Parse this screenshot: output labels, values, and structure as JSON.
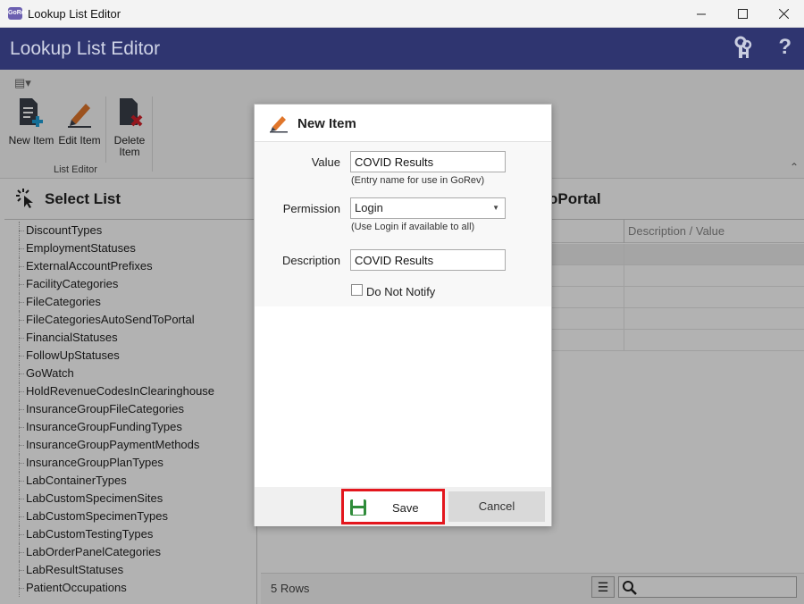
{
  "window": {
    "title": "Lookup List Editor",
    "icon_text": "GoRev",
    "controls": [
      "minimize",
      "maximize",
      "close"
    ]
  },
  "header": {
    "title": "Lookup List Editor",
    "icons": [
      "keys-icon",
      "help-icon"
    ],
    "help_glyph": "?"
  },
  "ribbon": {
    "menu_glyph": "▤▾",
    "buttons": [
      {
        "label": "New Item",
        "icon": "new-item-icon"
      },
      {
        "label": "Edit Item",
        "icon": "edit-item-icon"
      },
      {
        "label": "Delete Item",
        "icon": "delete-item-icon"
      }
    ],
    "group_label": "List Editor",
    "collapse_glyph": "⌃"
  },
  "left_panel": {
    "title": "Select List",
    "items": [
      "DiscountTypes",
      "EmploymentStatuses",
      "ExternalAccountPrefixes",
      "FacilityCategories",
      "FileCategories",
      "FileCategoriesAutoSendToPortal",
      "FinancialStatuses",
      "FollowUpStatuses",
      "GoWatch",
      "HoldRevenueCodesInClearinghouse",
      "InsuranceGroupFileCategories",
      "InsuranceGroupFundingTypes",
      "InsuranceGroupPaymentMethods",
      "InsuranceGroupPlanTypes",
      "LabContainerTypes",
      "LabCustomSpecimenSites",
      "LabCustomSpecimenTypes",
      "LabCustomTestingTypes",
      "LabOrderPanelCategories",
      "LabResultStatuses",
      "PatientOccupations"
    ]
  },
  "right_panel": {
    "title_fragment": "oPortal",
    "column_header": "Description / Value",
    "row_count": 5,
    "rows_label": "5 Rows",
    "menu_glyph": "☰"
  },
  "dialog": {
    "title": "New Item",
    "value_label": "Value",
    "value": "COVID Results",
    "value_hint": "(Entry name for use in GoRev)",
    "permission_label": "Permission",
    "permission": "Login",
    "permission_hint": "(Use Login if available to all)",
    "description_label": "Description",
    "description": "COVID Results",
    "notify_label": "Do Not Notify",
    "notify_checked": false,
    "save_label": "Save",
    "cancel_label": "Cancel",
    "accent_color": "#e3161d"
  }
}
